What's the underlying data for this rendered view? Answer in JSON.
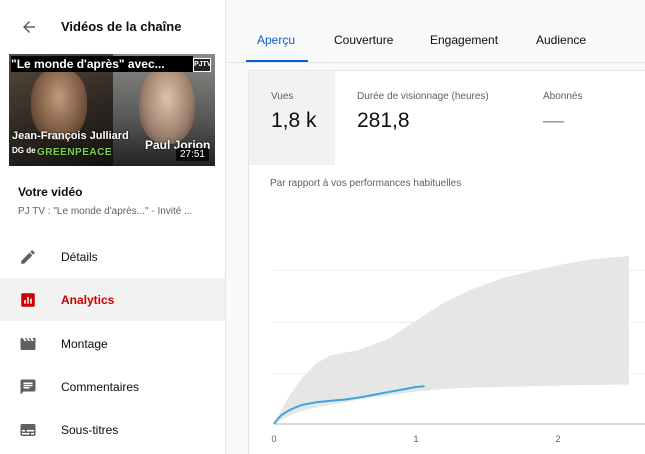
{
  "sidebar": {
    "title": "Vidéos de la chaîne",
    "thumbnail": {
      "headline": "\"Le monde d'après\" avec...",
      "logo": "PJTV",
      "person1": "Jean-François Julliard",
      "person1_role": "DG de",
      "org": "GREENPEACE",
      "person2": "Paul Jorion",
      "duration": "27:51"
    },
    "video_label": "Votre vidéo",
    "video_title": "PJ TV : \"Le monde d'après...\" - Invité ...",
    "nav": [
      {
        "label": "Détails",
        "icon": "pencil-icon"
      },
      {
        "label": "Analytics",
        "icon": "analytics-icon",
        "active": true
      },
      {
        "label": "Montage",
        "icon": "clapperboard-icon"
      },
      {
        "label": "Commentaires",
        "icon": "comment-icon"
      },
      {
        "label": "Sous-titres",
        "icon": "subtitles-icon"
      }
    ]
  },
  "tabs": [
    {
      "label": "Aperçu",
      "active": true
    },
    {
      "label": "Couverture"
    },
    {
      "label": "Engagement"
    },
    {
      "label": "Audience"
    }
  ],
  "metrics": [
    {
      "label": "Vues",
      "value": "1,8 k",
      "selected": true
    },
    {
      "label": "Durée de visionnage (heures)",
      "value": "281,8"
    },
    {
      "label": "Abonnés",
      "value": "—"
    }
  ],
  "comparison_label": "Par rapport à vos performances habituelles",
  "colors": {
    "accent": "#065fd4",
    "active_nav": "#cc0000",
    "line": "#3ea6d9",
    "band": "#e6e6e6"
  },
  "chart_data": {
    "type": "area",
    "x_ticks": [
      "0",
      "1",
      "2"
    ],
    "xlim": [
      0,
      2.6
    ],
    "series": [
      {
        "x": [
          0,
          0.02,
          0.05,
          0.1,
          0.15,
          0.2,
          0.3,
          0.4,
          0.5,
          0.6,
          0.7,
          0.8,
          0.9,
          1.0,
          1.06
        ],
        "y": [
          0,
          0.03,
          0.065,
          0.1,
          0.125,
          0.145,
          0.165,
          0.175,
          0.185,
          0.2,
          0.22,
          0.24,
          0.26,
          0.28,
          0.285
        ]
      }
    ],
    "band": {
      "x": [
        0,
        0.1,
        0.2,
        0.3,
        0.4,
        0.5,
        0.6,
        0.8,
        1.0,
        1.2,
        1.4,
        1.6,
        1.8,
        2.0,
        2.2,
        2.4,
        2.5
      ],
      "upper": [
        0,
        0.2,
        0.35,
        0.46,
        0.52,
        0.54,
        0.56,
        0.64,
        0.78,
        0.92,
        1.02,
        1.1,
        1.15,
        1.2,
        1.24,
        1.26,
        1.27
      ],
      "lower": [
        0,
        0.06,
        0.1,
        0.125,
        0.145,
        0.165,
        0.185,
        0.215,
        0.245,
        0.265,
        0.275,
        0.28,
        0.285,
        0.29,
        0.295,
        0.297,
        0.298
      ]
    }
  }
}
